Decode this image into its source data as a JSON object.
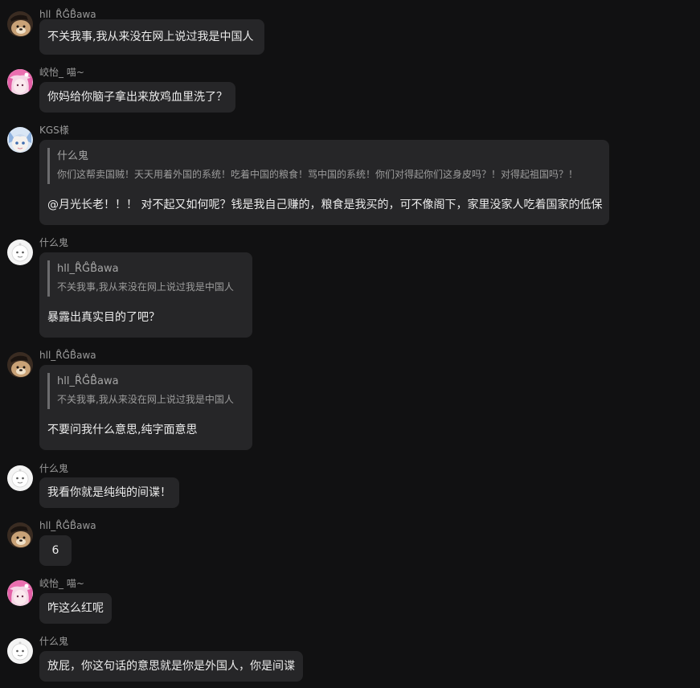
{
  "users": {
    "hll": "hll_R̊G̊B̊awa",
    "xiaoyi": "峧怡_ 喵~",
    "kgs": "KGS様",
    "shenme": "什么鬼"
  },
  "messages": [
    {
      "name": "hll_R̊G̊B̊awa",
      "text": "不关我事,我从来没在网上说过我是中国人"
    },
    {
      "name": "峧怡_ 喵~",
      "text": "你妈给你脑子拿出来放鸡血里洗了？"
    },
    {
      "name": "KGS様",
      "quote_title": "什么鬼",
      "quote_text": "你们这帮卖国贼！天天用着外国的系统！吃着中国的粮食！骂中国的系统！你们对得起你们这身皮吗？！对得起祖国吗？！",
      "text": "@月光长老！！！ 对不起又如何呢？钱是我自己赚的，粮食是我买的，可不像阁下，家里没家人吃着国家的低保"
    },
    {
      "name": "什么鬼",
      "quote_title": "hll_R̊G̊B̊awa",
      "quote_text": "不关我事,我从来没在网上说过我是中国人",
      "text": "暴露出真实目的了吧？"
    },
    {
      "name": "hll_R̊G̊B̊awa",
      "quote_title": "hll_R̊G̊B̊awa",
      "quote_text": "不关我事,我从来没在网上说过我是中国人",
      "text": "不要问我什么意思,纯字面意思"
    },
    {
      "name": "什么鬼",
      "text": "我看你就是纯纯的间谍！"
    },
    {
      "name": "hll_R̊G̊B̊awa",
      "text": "6"
    },
    {
      "name": "峧怡_ 喵~",
      "text": "咋这么红呢"
    },
    {
      "name": "什么鬼",
      "text": "放屁，你这句话的意思就是你是外国人，你是间谍"
    }
  ]
}
